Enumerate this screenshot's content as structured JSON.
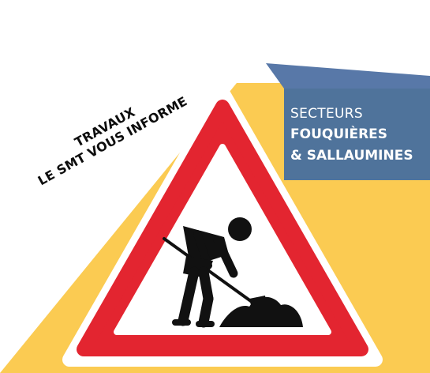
{
  "banner": {
    "line1": "TRAVAUX",
    "line2": "LE SMT VOUS INFORME"
  },
  "sector": {
    "label": "SECTEURS",
    "line1": "FOUQUIÈRES",
    "line2": "& SALLAUMINES"
  },
  "sign": {
    "icon": "roadwork-warning-sign-icon"
  },
  "colors": {
    "yellow_background": "#FBCB52",
    "blue_panel": "#4F739B",
    "blue_panel_top": "#5878A8",
    "sign_red": "#E32530",
    "sign_black": "#111111",
    "sign_white": "#FFFFFF"
  }
}
